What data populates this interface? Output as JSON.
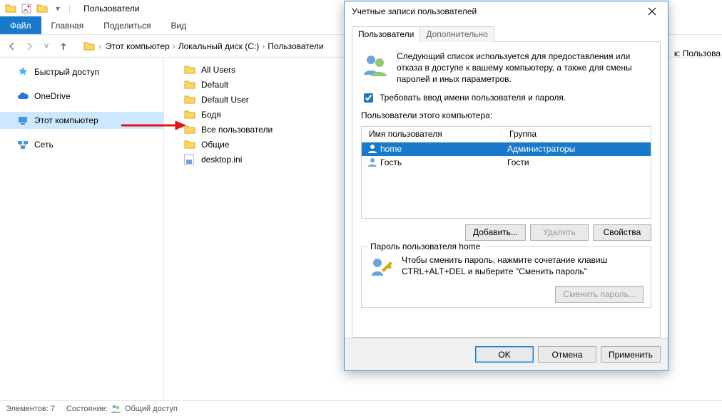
{
  "explorer": {
    "title": "Пользователи",
    "ribbon": {
      "file": "Файл",
      "home": "Главная",
      "share": "Поделиться",
      "view": "Вид"
    },
    "breadcrumb": [
      "Этот компьютер",
      "Локальный диск (C:)",
      "Пользователи"
    ],
    "sidebar": {
      "quick": "Быстрый доступ",
      "onedrive": "OneDrive",
      "thispc": "Этот компьютер",
      "network": "Сеть"
    },
    "files": [
      "All Users",
      "Default",
      "Default User",
      "Бодя",
      "Все пользователи",
      "Общие",
      "desktop.ini"
    ],
    "status": {
      "count_label": "Элементов: 7",
      "state_label": "Состояние:",
      "share": "Общий доступ"
    },
    "rightcut": "к: Пользова"
  },
  "dialog": {
    "title": "Учетные записи пользователей",
    "tabs": {
      "users": "Пользователи",
      "advanced": "Дополнительно"
    },
    "intro": "Следующий список используется для предоставления или отказа в доступе к вашему компьютеру, а также для смены паролей и иных параметров.",
    "require_checkbox": "Требовать ввод имени пользователя и пароля.",
    "list_label": "Пользователи этого компьютера:",
    "cols": {
      "user": "Имя пользователя",
      "group": "Группа"
    },
    "rows": [
      {
        "user": "home",
        "group": "Администраторы",
        "selected": true
      },
      {
        "user": "Гость",
        "group": "Гости",
        "selected": false
      }
    ],
    "btns": {
      "add": "Добавить...",
      "remove": "Удалить",
      "props": "Свойства"
    },
    "pw": {
      "legend": "Пароль пользователя home",
      "text": "Чтобы сменить пароль, нажмите сочетание клавиш CTRL+ALT+DEL и выберите \"Сменить пароль\"",
      "change": "Сменить пароль..."
    },
    "footer": {
      "ok": "OK",
      "cancel": "Отмена",
      "apply": "Применить"
    }
  }
}
